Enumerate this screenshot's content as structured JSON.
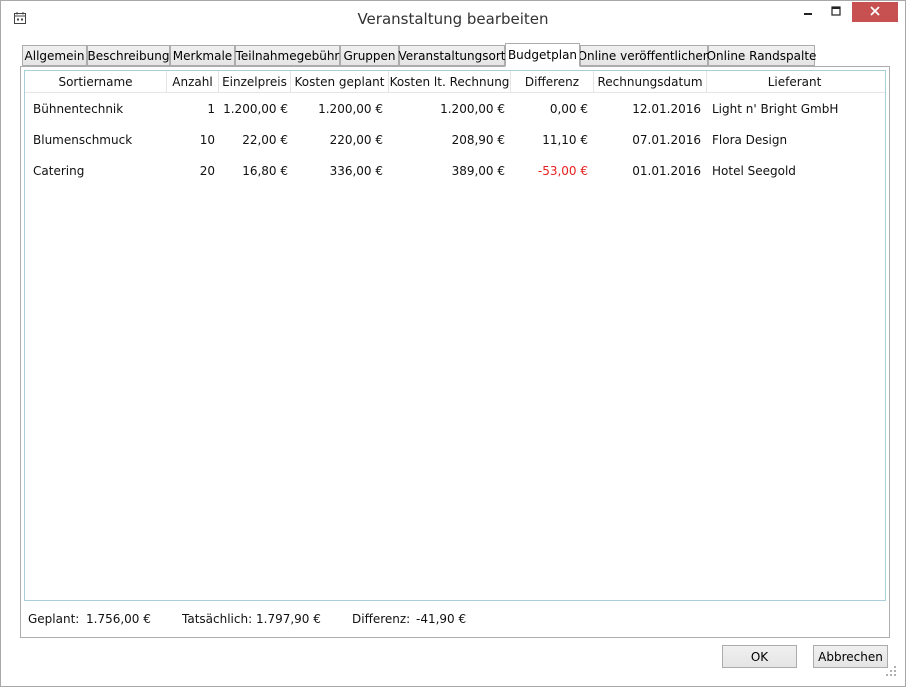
{
  "window": {
    "title": "Veranstaltung bearbeiten",
    "icons": {
      "app": "calendar-edit-icon",
      "minimize": "minimize-icon",
      "maximize": "maximize-icon",
      "close": "close-icon"
    }
  },
  "tabs": [
    {
      "label": "Allgemein",
      "active": false
    },
    {
      "label": "Beschreibung",
      "active": false
    },
    {
      "label": "Merkmale",
      "active": false
    },
    {
      "label": "Teilnahmegebühr",
      "active": false
    },
    {
      "label": "Gruppen",
      "active": false
    },
    {
      "label": "Veranstaltungsort",
      "active": false
    },
    {
      "label": "Budgetplan",
      "active": true
    },
    {
      "label": "Online veröffentlichen",
      "active": false
    },
    {
      "label": "Online Randspalte",
      "active": false
    }
  ],
  "grid": {
    "columns": [
      "Sortiername",
      "Anzahl",
      "Einzelpreis",
      "Kosten geplant",
      "Kosten lt. Rechnung",
      "Differenz",
      "Rechnungsdatum",
      "Lieferant"
    ],
    "rows": [
      {
        "sortiername": "Bühnentechnik",
        "anzahl": "1",
        "einzelpreis": "1.200,00 €",
        "kosten_geplant": "1.200,00 €",
        "kosten_rechnung": "1.200,00 €",
        "differenz": "0,00 €",
        "rechnungsdatum": "12.01.2016",
        "lieferant": "Light n' Bright GmbH",
        "negative": false
      },
      {
        "sortiername": "Blumenschmuck",
        "anzahl": "10",
        "einzelpreis": "22,00 €",
        "kosten_geplant": "220,00 €",
        "kosten_rechnung": "208,90 €",
        "differenz": "11,10 €",
        "rechnungsdatum": "07.01.2016",
        "lieferant": "Flora Design",
        "negative": false
      },
      {
        "sortiername": "Catering",
        "anzahl": "20",
        "einzelpreis": "16,80 €",
        "kosten_geplant": "336,00 €",
        "kosten_rechnung": "389,00 €",
        "differenz": "-53,00 €",
        "rechnungsdatum": "01.01.2016",
        "lieferant": "Hotel Seegold",
        "negative": true
      }
    ]
  },
  "summary": {
    "geplant_label": "Geplant:",
    "geplant_value": "1.756,00 €",
    "tatsaechlich_label": "Tatsächlich:",
    "tatsaechlich_value": "1.797,90 €",
    "differenz_label": "Differenz:",
    "differenz_value": "-41,90 €"
  },
  "buttons": {
    "ok": "OK",
    "cancel": "Abbrechen"
  },
  "colors": {
    "negative": "#e81e1e",
    "close_button": "#c75050",
    "grid_border": "#a9cfd9"
  }
}
